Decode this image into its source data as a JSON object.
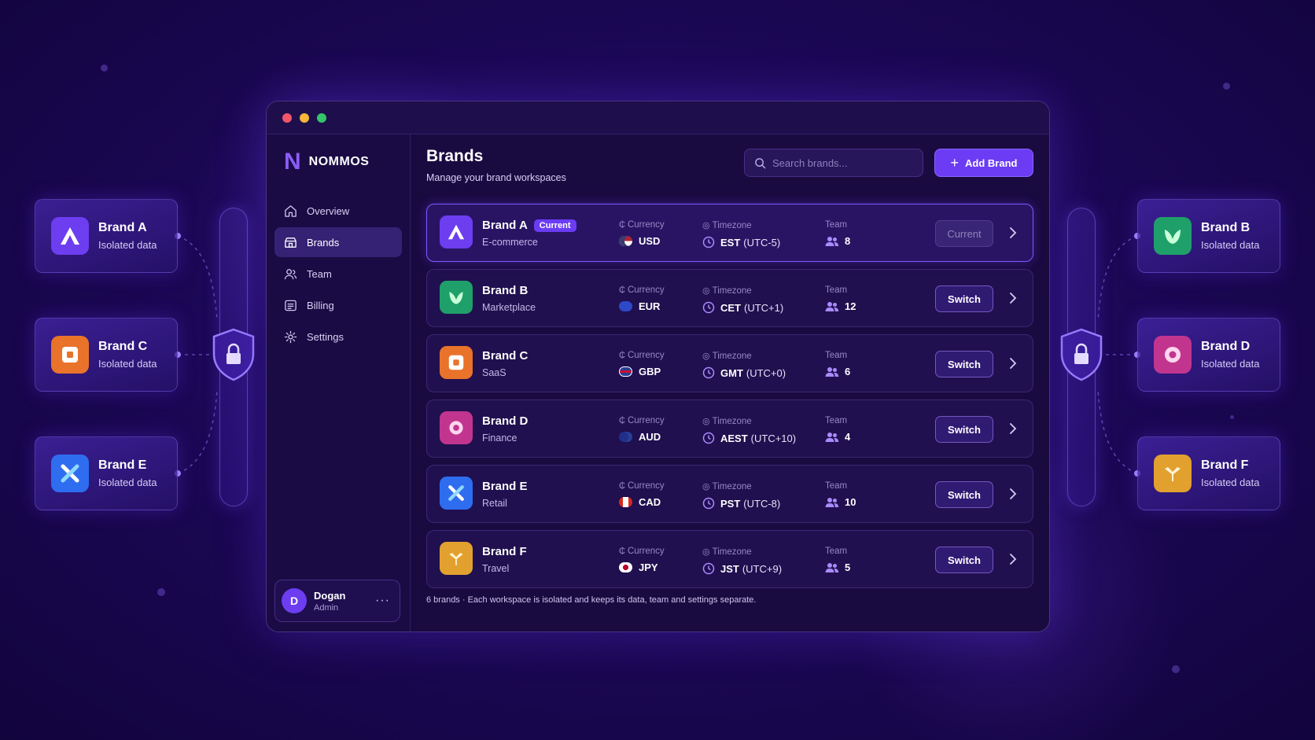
{
  "app": {
    "name": "NOMMOS",
    "logo_mark": "N"
  },
  "sidebar": {
    "items": [
      {
        "label": "Overview",
        "icon": "home-icon"
      },
      {
        "label": "Brands",
        "icon": "brands-icon"
      },
      {
        "label": "Team",
        "icon": "team-icon"
      },
      {
        "label": "Billing",
        "icon": "billing-icon"
      },
      {
        "label": "Settings",
        "icon": "gear-icon"
      }
    ],
    "active": "Brands",
    "user": {
      "initial": "D",
      "name": "Dogan",
      "role": "Admin",
      "more": "···"
    }
  },
  "header": {
    "title": "Brands",
    "subtitle": "Manage your brand workspaces",
    "search_placeholder": "Search brands...",
    "add_label": "Add Brand"
  },
  "columns": {
    "currency": "Currency",
    "timezone": "Timezone",
    "team": "Team"
  },
  "brands": [
    {
      "name": "Brand A",
      "category": "E-commerce",
      "badge": "Current",
      "currency": "USD",
      "tz": "EST",
      "offset": "(UTC-5)",
      "team": "8",
      "action": "Current",
      "color": "#6d3df0"
    },
    {
      "name": "Brand B",
      "category": "Marketplace",
      "currency": "EUR",
      "tz": "CET",
      "offset": "(UTC+1)",
      "team": "12",
      "action": "Switch",
      "color": "#1fa06a"
    },
    {
      "name": "Brand C",
      "category": "SaaS",
      "currency": "GBP",
      "tz": "GMT",
      "offset": "(UTC+0)",
      "team": "6",
      "action": "Switch",
      "color": "#e9732a"
    },
    {
      "name": "Brand D",
      "category": "Finance",
      "currency": "AUD",
      "tz": "AEST",
      "offset": "(UTC+10)",
      "team": "4",
      "action": "Switch",
      "color": "#c2358f"
    },
    {
      "name": "Brand E",
      "category": "Retail",
      "currency": "CAD",
      "tz": "PST",
      "offset": "(UTC-8)",
      "team": "10",
      "action": "Switch",
      "color": "#2f6df0"
    },
    {
      "name": "Brand F",
      "category": "Travel",
      "currency": "JPY",
      "tz": "JST",
      "offset": "(UTC+9)",
      "team": "5",
      "action": "Switch",
      "color": "#e2a12f"
    }
  ],
  "footer_note": "6 brands · Each workspace is isolated and keeps its data, team and settings separate.",
  "side_cards": [
    {
      "name": "Brand A",
      "sub": "Isolated data"
    },
    {
      "name": "Brand C",
      "sub": "Isolated data"
    },
    {
      "name": "Brand E",
      "sub": "Isolated data"
    },
    {
      "name": "Brand B",
      "sub": "Isolated data"
    },
    {
      "name": "Brand D",
      "sub": "Isolated data"
    },
    {
      "name": "Brand F",
      "sub": "Isolated data"
    }
  ]
}
